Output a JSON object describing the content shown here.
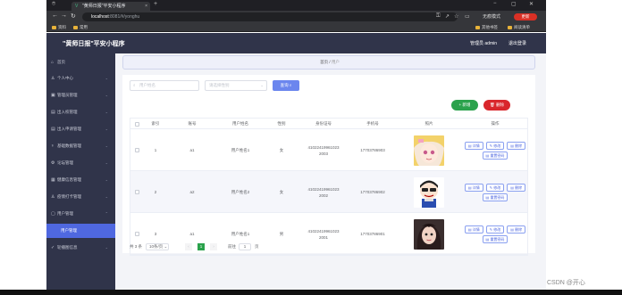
{
  "browser": {
    "tab_title": "\"黄师日报\"平安小程序",
    "url_host": "localhost",
    "url_path": ":8081/#/yonghu",
    "incognito_label": "无痕模式",
    "update_label": "更新",
    "bookmarks": [
      "资料",
      "常用"
    ],
    "bookmarks_right": [
      "其他书签",
      "阅读清单"
    ]
  },
  "app": {
    "title": "\"黄师日报\"平安小程序",
    "admin_label": "管理员 admin",
    "logout_label": "退出登录"
  },
  "sidebar": {
    "items": [
      {
        "label": "首页",
        "icon": "home-icon"
      },
      {
        "label": "个人中心",
        "icon": "user-icon"
      },
      {
        "label": "管理员管理",
        "icon": "admin-icon"
      },
      {
        "label": "出入校管理",
        "icon": "door-icon"
      },
      {
        "label": "出入申请管理",
        "icon": "doc-icon"
      },
      {
        "label": "基础数据管理",
        "icon": "data-icon"
      },
      {
        "label": "论坛管理",
        "icon": "forum-icon"
      },
      {
        "label": "健康信息管理",
        "icon": "health-icon"
      },
      {
        "label": "疫情打卡管理",
        "icon": "checkin-icon"
      },
      {
        "label": "用户管理",
        "icon": "users-icon"
      },
      {
        "label": "用户管理",
        "icon": ""
      },
      {
        "label": "轮播图信息",
        "icon": "carousel-icon"
      }
    ]
  },
  "breadcrumb": {
    "home": "首页",
    "sep": "/",
    "current": "用户"
  },
  "search": {
    "name_placeholder": "用户姓名",
    "gender_placeholder": "请选择性别",
    "search_label": "查询"
  },
  "actions": {
    "add_label": "+ 新增",
    "delete_label": "删除"
  },
  "table": {
    "headers": [
      "索引",
      "账号",
      "用户姓名",
      "性别",
      "身份证号",
      "手机号",
      "照片",
      "操作"
    ],
    "rows": [
      {
        "index": "1",
        "account": "a1",
        "name": "用户姓名1",
        "gender": "女",
        "id_line1": "41022419961023",
        "id_line2": "2003",
        "phone": "17703786903"
      },
      {
        "index": "2",
        "account": "a2",
        "name": "用户姓名2",
        "gender": "女",
        "id_line1": "41022419961023",
        "id_line2": "2002",
        "phone": "17703786902"
      },
      {
        "index": "3",
        "account": "a1",
        "name": "用户姓名1",
        "gender": "男",
        "id_line1": "41022419961023",
        "id_line2": "2001",
        "phone": "17703786901"
      }
    ],
    "op_labels": {
      "detail": "详情",
      "edit": "修改",
      "delete": "删除",
      "reset": "重置密码"
    }
  },
  "pager": {
    "total": "共 3 条",
    "size": "10条/页",
    "current": "1",
    "goto_label": "前往",
    "goto_value": "1",
    "page_unit": "页"
  },
  "watermark": "CSDN @开心"
}
